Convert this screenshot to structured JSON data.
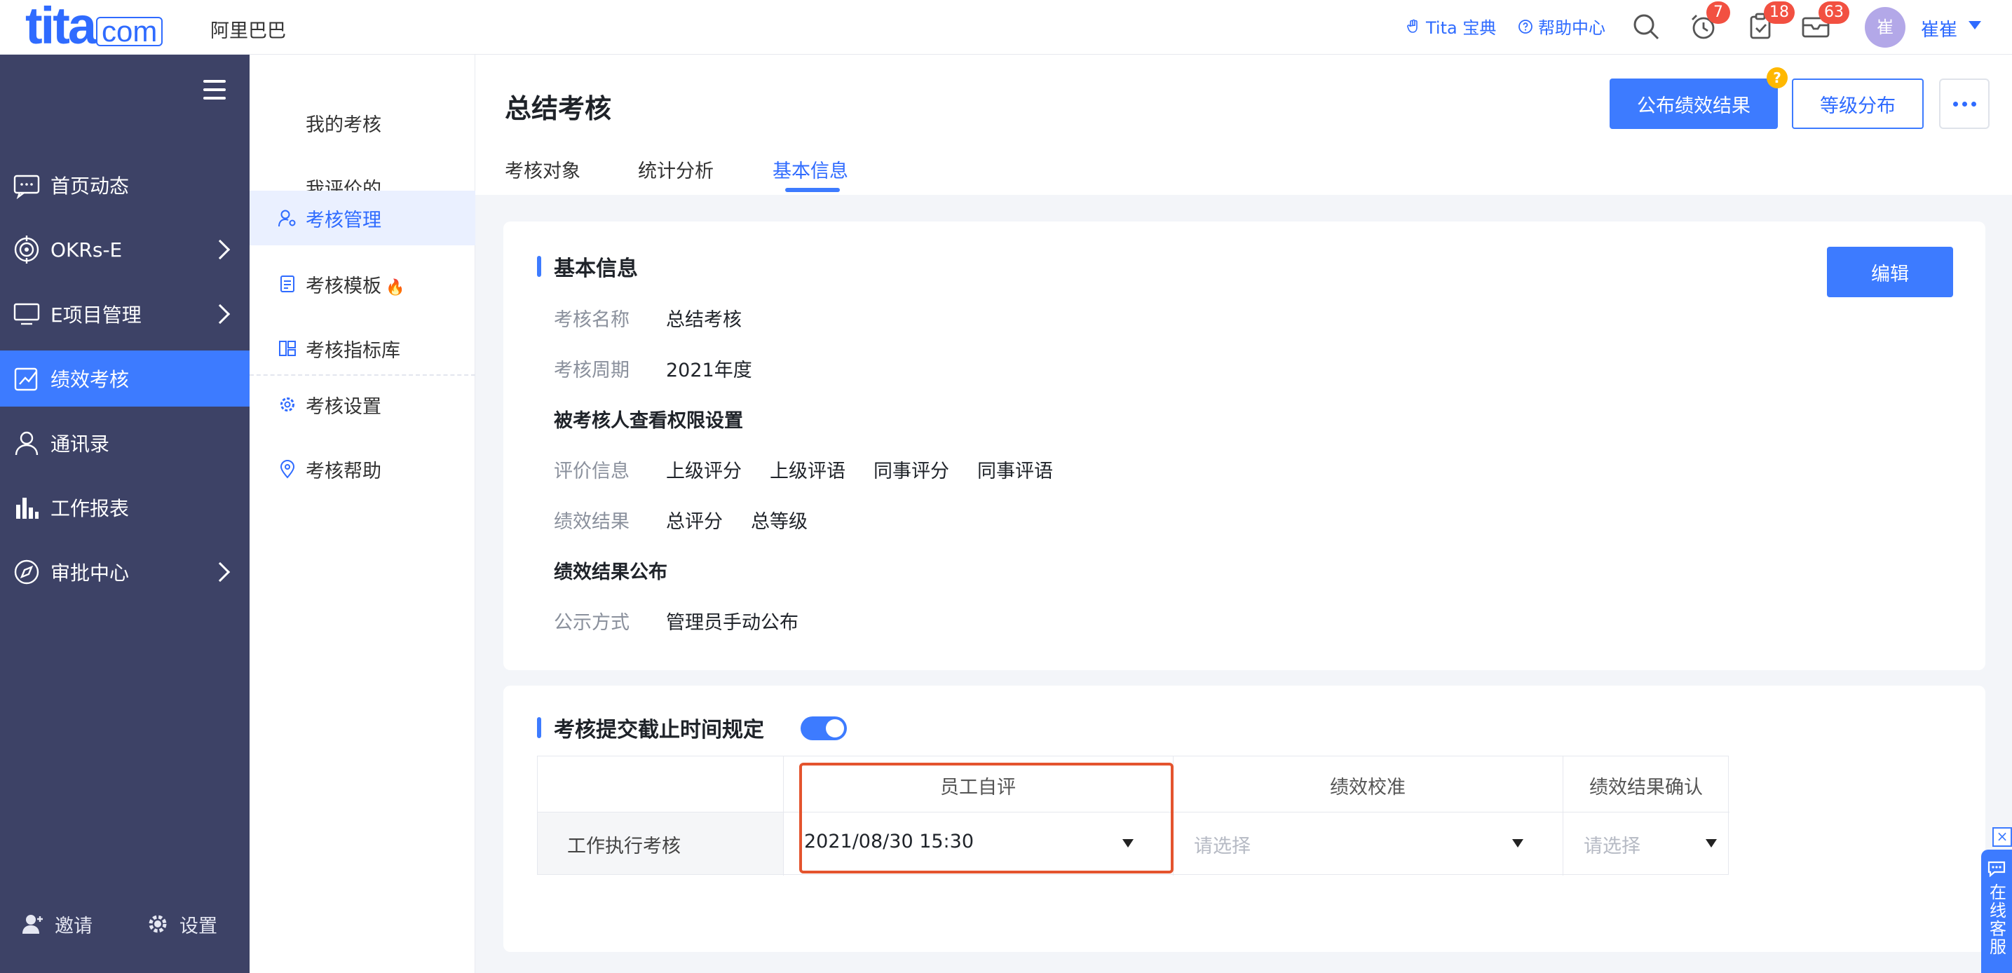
{
  "header": {
    "logo_main": "tita",
    "logo_suffix": "com",
    "company": "阿里巴巴",
    "links": {
      "tita_guide": "Tita 宝典",
      "help_center": "帮助中心"
    },
    "badges": {
      "reminders": "7",
      "tasks": "18",
      "messages": "63"
    },
    "avatar_text": "崔",
    "username": "崔崔"
  },
  "sidebar": {
    "items": [
      {
        "label": "首页动态",
        "icon": "chat-icon"
      },
      {
        "label": "OKRs-E",
        "icon": "target-icon"
      },
      {
        "label": "E项目管理",
        "icon": "monitor-icon"
      },
      {
        "label": "绩效考核",
        "icon": "chart-icon"
      },
      {
        "label": "通讯录",
        "icon": "user-icon"
      },
      {
        "label": "工作报表",
        "icon": "bar-chart-icon"
      },
      {
        "label": "审批中心",
        "icon": "compass-icon"
      }
    ],
    "footer": {
      "invite": "邀请",
      "settings": "设置"
    }
  },
  "submenu": {
    "items": [
      {
        "label": "我的考核"
      },
      {
        "label": "我评价的"
      },
      {
        "label": "考核管理"
      },
      {
        "label": "考核模板"
      },
      {
        "label": "考核指标库"
      },
      {
        "label": "考核设置"
      },
      {
        "label": "考核帮助"
      }
    ]
  },
  "main": {
    "title": "总结考核",
    "buttons": {
      "publish": "公布绩效结果",
      "grade_distribution": "等级分布",
      "edit": "编辑"
    },
    "help_mark": "?",
    "tabs": [
      {
        "label": "考核对象"
      },
      {
        "label": "统计分析"
      },
      {
        "label": "基本信息"
      }
    ],
    "basic_info": {
      "title": "基本信息",
      "name_label": "考核名称",
      "name_value": "总结考核",
      "period_label": "考核周期",
      "period_value": "2021年度",
      "perm_heading": "被考核人查看权限设置",
      "eval_label": "评价信息",
      "eval_values": [
        "上级评分",
        "上级评语",
        "同事评分",
        "同事评语"
      ],
      "result_label": "绩效结果",
      "result_values": [
        "总评分",
        "总等级"
      ],
      "publish_heading": "绩效结果公布",
      "publish_label": "公示方式",
      "publish_value": "管理员手动公布"
    },
    "deadline": {
      "title": "考核提交截止时间规定",
      "toggle_on": true,
      "columns": [
        "员工自评",
        "绩效校准",
        "绩效结果确认"
      ],
      "row_label": "工作执行考核",
      "values": [
        "2021/08/30 15:30",
        "请选择",
        "请选择"
      ]
    }
  },
  "cs_widget": {
    "label": "在线客服",
    "close": "×"
  },
  "colors": {
    "accent": "#3d7bff",
    "sidebar": "#3d4266",
    "highlight": "#e4542e"
  }
}
